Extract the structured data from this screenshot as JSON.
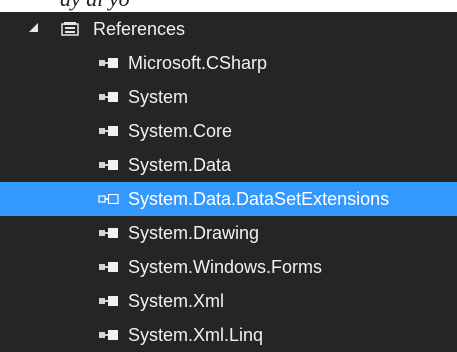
{
  "top_fragment": "ay al yo",
  "tree": {
    "root": {
      "label": "References",
      "expanded": true
    },
    "items": [
      {
        "label": "Microsoft.CSharp",
        "icon": "reference-icon",
        "selected": false
      },
      {
        "label": "System",
        "icon": "reference-icon",
        "selected": false
      },
      {
        "label": "System.Core",
        "icon": "reference-icon",
        "selected": false
      },
      {
        "label": "System.Data",
        "icon": "reference-icon",
        "selected": false
      },
      {
        "label": "System.Data.DataSetExtensions",
        "icon": "reference-icon",
        "selected": true
      },
      {
        "label": "System.Drawing",
        "icon": "reference-icon",
        "selected": false
      },
      {
        "label": "System.Windows.Forms",
        "icon": "reference-icon",
        "selected": false
      },
      {
        "label": "System.Xml",
        "icon": "reference-icon",
        "selected": false
      },
      {
        "label": "System.Xml.Linq",
        "icon": "reference-icon",
        "selected": false
      }
    ]
  },
  "colors": {
    "background": "#252526",
    "text": "#f1f1f1",
    "selection": "#3399ff",
    "icon": "#e6e6e6"
  }
}
